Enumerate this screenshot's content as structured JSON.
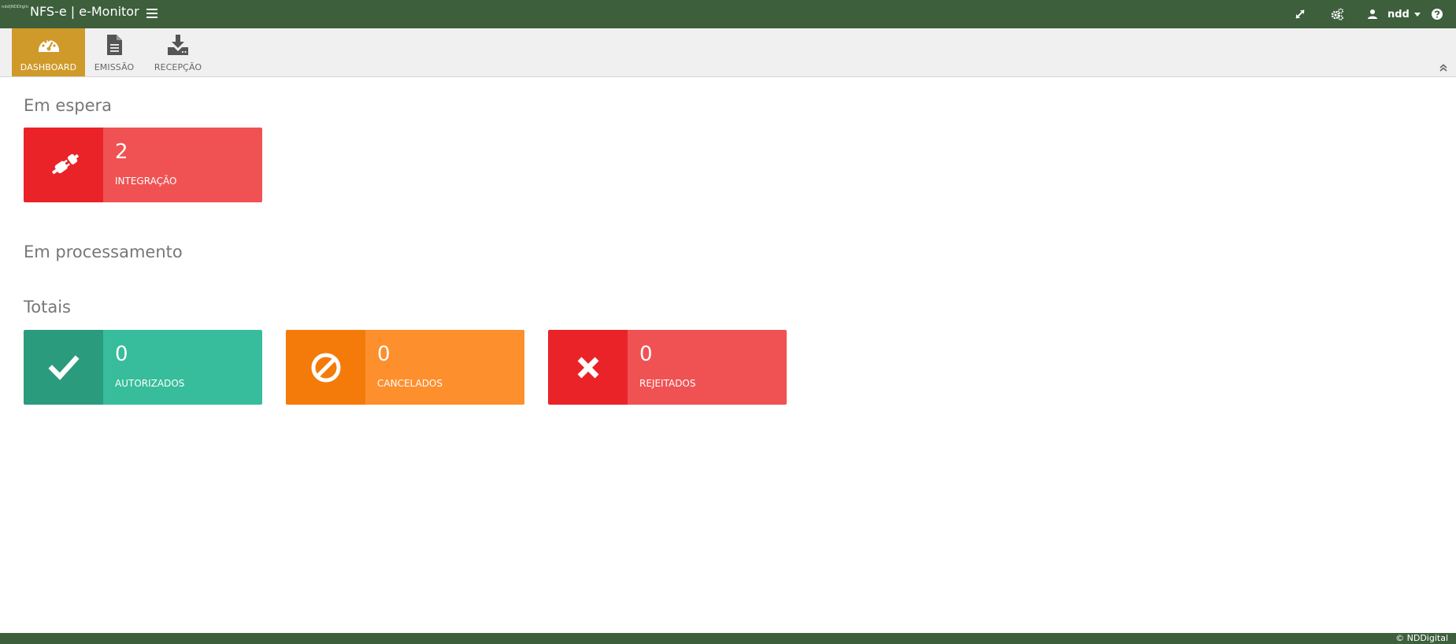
{
  "header": {
    "logo_text": "ndd|NDDigital",
    "app_title": "NFS-e | e-Monitor",
    "user_name": "ndd",
    "icons": [
      "menu-icon",
      "expand-icon",
      "cogs-icon",
      "user-icon",
      "help-icon"
    ]
  },
  "nav": {
    "items": [
      {
        "label": "DASHBOARD",
        "icon": "dashboard-icon",
        "active": true
      },
      {
        "label": "EMISSÃO",
        "icon": "document-icon",
        "active": false
      },
      {
        "label": "RECEPÇÃO",
        "icon": "download-icon",
        "active": false
      }
    ],
    "collapse_icon": "double-chevron-up-icon"
  },
  "sections": {
    "waiting": {
      "title": "Em espera",
      "tiles": [
        {
          "count": "2",
          "label": "INTEGRAÇÃO",
          "icon": "plug-icon",
          "icon_color": "#ea2328",
          "body_color": "#f05253"
        }
      ]
    },
    "processing": {
      "title": "Em processamento"
    },
    "totals": {
      "title": "Totais",
      "tiles": [
        {
          "count": "0",
          "label": "AUTORIZADOS",
          "icon": "check-icon",
          "icon_color": "#2a9b7d",
          "body_color": "#37bd9b"
        },
        {
          "count": "0",
          "label": "CANCELADOS",
          "icon": "ban-icon",
          "icon_color": "#f47b0a",
          "body_color": "#fd8f2d"
        },
        {
          "count": "0",
          "label": "REJEITADOS",
          "icon": "close-icon",
          "icon_color": "#ea2328",
          "body_color": "#f05253"
        }
      ]
    }
  },
  "footer": {
    "text": "© NDDigital"
  },
  "colors": {
    "topbar": "#3d5f3c",
    "nav_active": "#cf9a2a",
    "nav_bg": "#f0f0f0"
  }
}
